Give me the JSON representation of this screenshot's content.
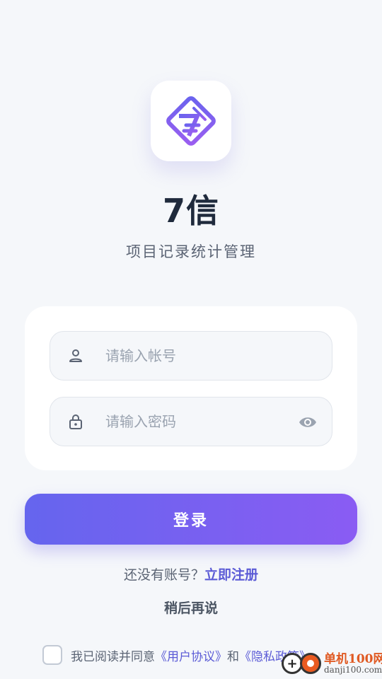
{
  "app": {
    "name": "7信",
    "subtitle": "项目记录统计管理"
  },
  "form": {
    "username_placeholder": "请输入帐号",
    "password_placeholder": "请输入密码",
    "login_label": "登录"
  },
  "register": {
    "prompt": "还没有账号？",
    "link": "立即注册"
  },
  "later_label": "稍后再说",
  "agreement": {
    "prefix": "我已阅读并同意",
    "user_agreement": "《用户协议》",
    "and": "和",
    "privacy_policy": "《隐私政策》",
    "checked": false
  },
  "watermark": {
    "line1": "单机100网",
    "line2": "danji100.com"
  },
  "colors": {
    "accent": "#5b5bd6",
    "button_start": "#6565ee",
    "button_end": "#8a5cf3",
    "background": "#f5f7fa"
  },
  "icons": [
    "app-logo-icon",
    "user-icon",
    "lock-icon",
    "eye-icon"
  ]
}
